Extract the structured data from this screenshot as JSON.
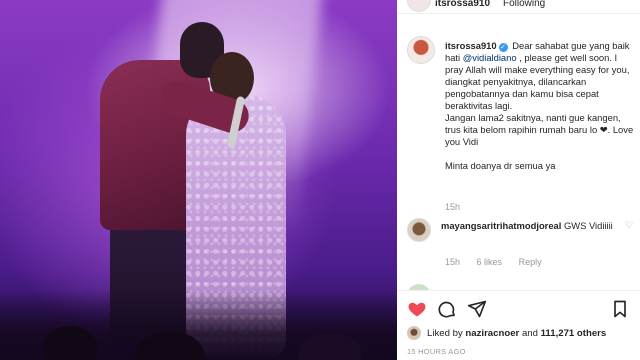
{
  "header": {
    "username": "itsrossa910",
    "follow_label": "Following"
  },
  "post": {
    "author": "itsrossa910",
    "caption": {
      "line1": "Dear sahabat gue yang baik hati",
      "mention": "@vidialdiano",
      "line1_rest": ", please get well soon. I pray Allah will make everything easy for you, diangkat penyakitnya, dilancarkan pengobatannya dan kamu bisa cepat beraktivitas lagi.",
      "line2": "Jangan lama2 sakitnya, nanti gue kangen, trus kita belom rapihin rumah baru lo",
      "line2_end": ". Love you Vidi",
      "line3": "Minta doanya dr semua ya"
    },
    "caption_time": "15h"
  },
  "comments": [
    {
      "username": "mayangsaritrihatmodjoreal",
      "text": "GWS Vidiiiii",
      "time": "15h",
      "likes": "6 likes",
      "reply_label": "Reply"
    }
  ],
  "likes_row": {
    "prefix": "Liked by",
    "user": "naziracnoer",
    "connector": "and",
    "count": "111,271 others"
  },
  "timestamp": "15 HOURS AGO",
  "icons": [
    "heart-icon",
    "comment-icon",
    "share-icon",
    "bookmark-icon"
  ],
  "colors": {
    "like_red": "#ed4956",
    "link_blue": "#003569",
    "verified_blue": "#3897f0",
    "muted": "#999999"
  }
}
